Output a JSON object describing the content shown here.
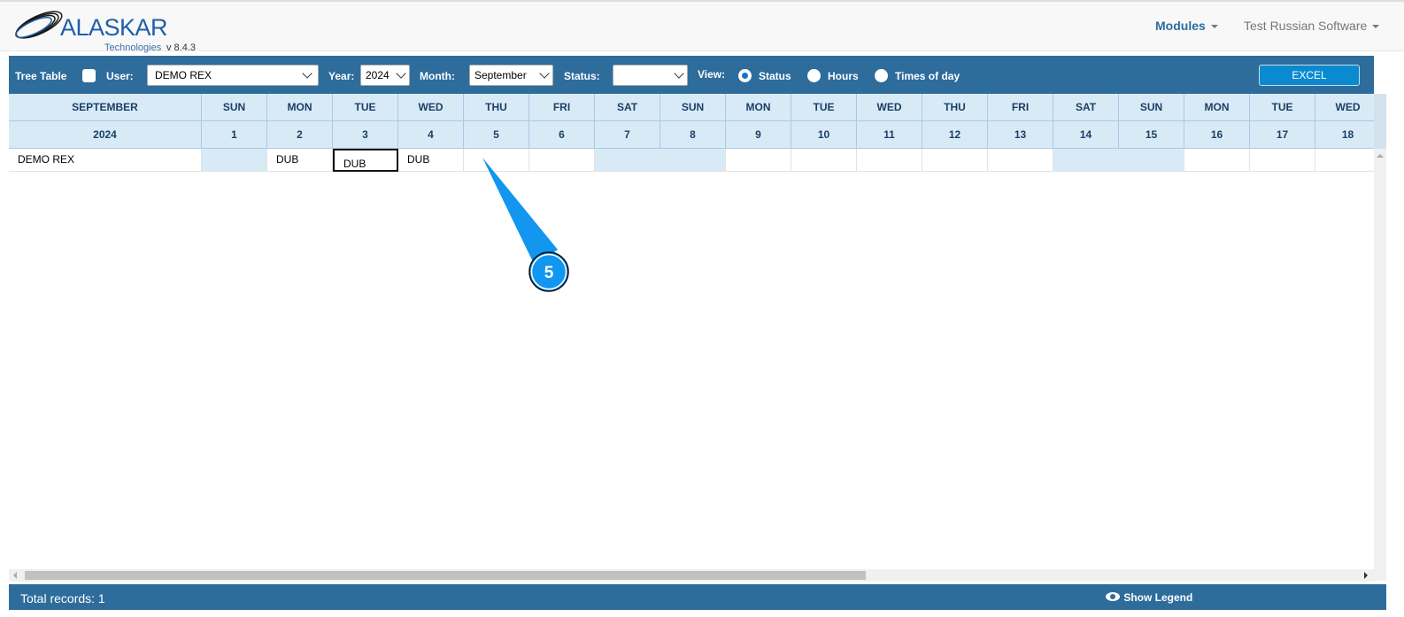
{
  "header": {
    "logo": "ALASKAR",
    "logo_sub": "Technologies",
    "version": "v 8.4.3",
    "nav": [
      {
        "label": "Modules"
      },
      {
        "label": "Test Russian Software"
      }
    ]
  },
  "toolbar": {
    "tree_table": "Tree Table",
    "user_label": "User:",
    "user_value": "DEMO REX",
    "year_label": "Year:",
    "year_value": "2024",
    "month_label": "Month:",
    "month_value": "September",
    "status_label": "Status:",
    "status_value": "",
    "view_label": "View:",
    "view_options": [
      "Status",
      "Hours",
      "Times of day"
    ],
    "view_selected": "Status",
    "excel": "EXCEL"
  },
  "table": {
    "month": "SEPTEMBER",
    "year": "2024",
    "days": [
      [
        "SUN",
        "1"
      ],
      [
        "MON",
        "2"
      ],
      [
        "TUE",
        "3"
      ],
      [
        "WED",
        "4"
      ],
      [
        "THU",
        "5"
      ],
      [
        "FRI",
        "6"
      ],
      [
        "SAT",
        "7"
      ],
      [
        "SUN",
        "8"
      ],
      [
        "MON",
        "9"
      ],
      [
        "TUE",
        "10"
      ],
      [
        "WED",
        "11"
      ],
      [
        "THU",
        "12"
      ],
      [
        "FRI",
        "13"
      ],
      [
        "SAT",
        "14"
      ],
      [
        "SUN",
        "15"
      ],
      [
        "MON",
        "16"
      ],
      [
        "TUE",
        "17"
      ],
      [
        "WED",
        "18"
      ]
    ],
    "rows": [
      {
        "name": "DEMO REX",
        "values": [
          "",
          "DUB",
          "DUB",
          "DUB",
          "",
          "",
          "",
          "",
          "",
          "",
          "",
          "",
          "",
          "",
          "",
          "",
          "",
          ""
        ]
      }
    ]
  },
  "footer": {
    "total": "Total records: 1",
    "legend": "Show Legend"
  },
  "callout": {
    "number": "5",
    "color": "#1296f0"
  }
}
